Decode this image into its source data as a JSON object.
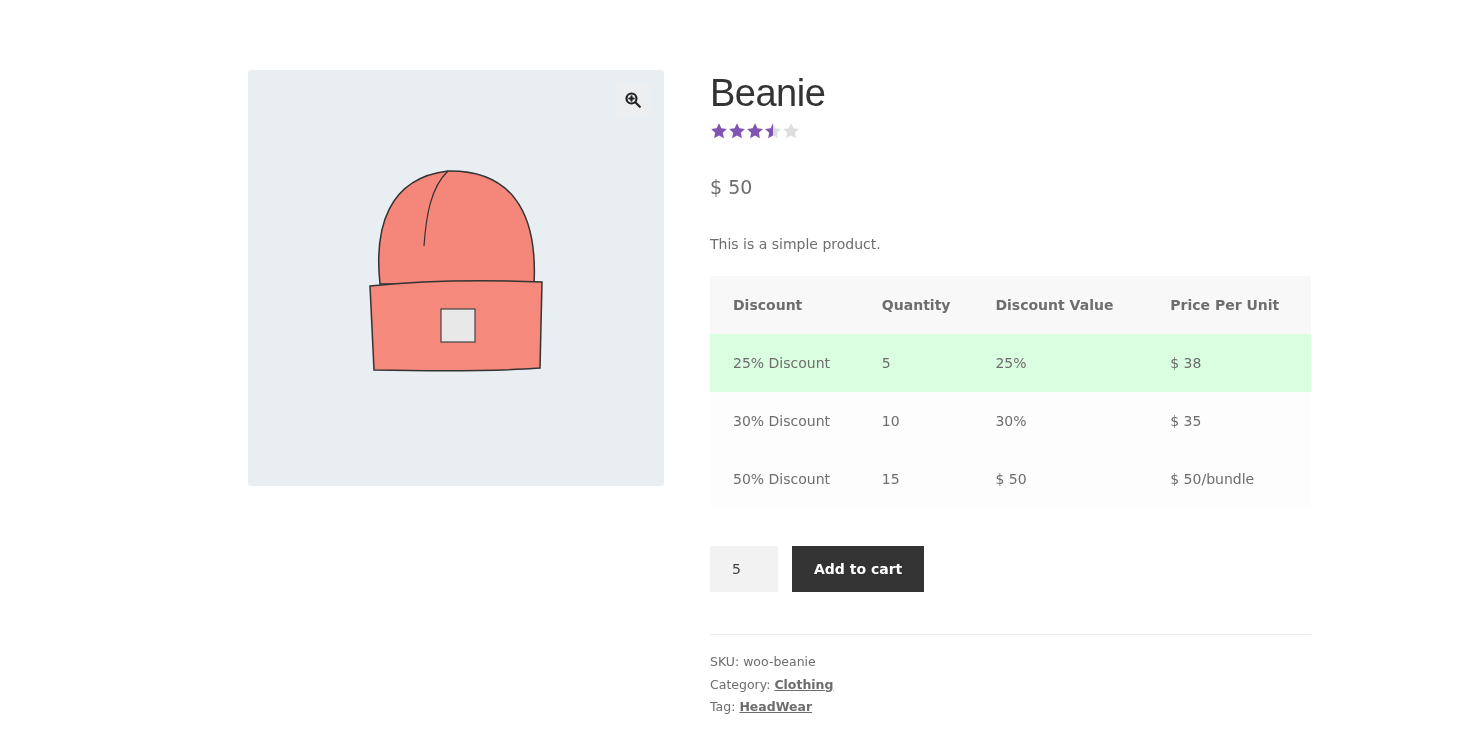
{
  "product": {
    "title": "Beanie",
    "stars": 3.5,
    "price": "$ 50",
    "description": "This is a simple product."
  },
  "discount_table": {
    "columns": [
      "Discount",
      "Quantity",
      "Discount Value",
      "Price Per Unit"
    ],
    "rows": [
      {
        "cells": [
          "25% Discount",
          "5",
          "25%",
          "$ 38"
        ],
        "selected": true
      },
      {
        "cells": [
          "30% Discount",
          "10",
          "30%",
          "$ 35"
        ],
        "selected": false
      },
      {
        "cells": [
          "50% Discount",
          "15",
          "$ 50",
          "$ 50/bundle"
        ],
        "selected": false
      }
    ]
  },
  "quantity": "5",
  "add_to_cart": "Add to cart",
  "meta": [
    {
      "label": "SKU: woo-beanie"
    },
    {
      "label": "Category:",
      "link": "Clothing"
    },
    {
      "label": "Tag:",
      "link": "HeadWear"
    }
  ]
}
